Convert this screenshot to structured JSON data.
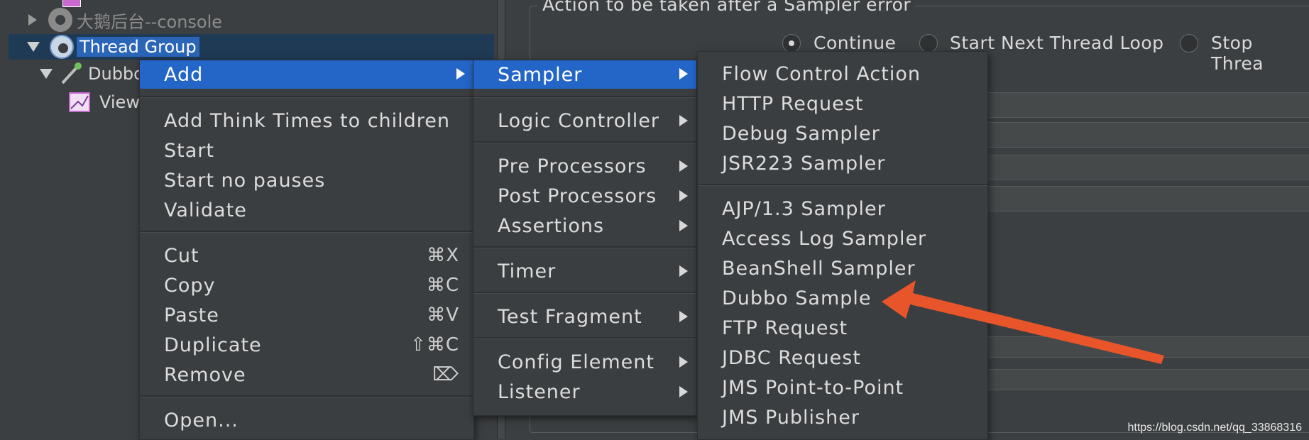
{
  "tree": {
    "items": [
      {
        "label": "大鹅后台--console"
      },
      {
        "label": "Thread Group"
      },
      {
        "label": "Dubbo"
      },
      {
        "label": "View"
      }
    ]
  },
  "error_panel": {
    "title": "Action to be taken after a Sampler error",
    "options": [
      "Continue",
      "Start Next Thread Loop",
      "Stop Threa"
    ],
    "selected": "Continue"
  },
  "context_menu": {
    "items": [
      {
        "label": "Add",
        "shortcut": "",
        "submenu": true
      },
      {
        "label": "Add Think Times to children",
        "shortcut": ""
      },
      {
        "label": "Start",
        "shortcut": ""
      },
      {
        "label": "Start no pauses",
        "shortcut": ""
      },
      {
        "label": "Validate",
        "shortcut": ""
      },
      {
        "label": "Cut",
        "shortcut": "⌘X"
      },
      {
        "label": "Copy",
        "shortcut": "⌘C"
      },
      {
        "label": "Paste",
        "shortcut": "⌘V"
      },
      {
        "label": "Duplicate",
        "shortcut": "⇧⌘C"
      },
      {
        "label": "Remove",
        "shortcut": "⌦"
      },
      {
        "label": "Open...",
        "shortcut": ""
      }
    ]
  },
  "add_submenu": {
    "items": [
      {
        "label": "Sampler"
      },
      {
        "label": "Logic Controller"
      },
      {
        "label": "Pre Processors"
      },
      {
        "label": "Post Processors"
      },
      {
        "label": "Assertions"
      },
      {
        "label": "Timer"
      },
      {
        "label": "Test Fragment"
      },
      {
        "label": "Config Element"
      },
      {
        "label": "Listener"
      }
    ]
  },
  "sampler_submenu": {
    "items": [
      {
        "label": "Flow Control Action"
      },
      {
        "label": "HTTP Request"
      },
      {
        "label": "Debug Sampler"
      },
      {
        "label": "JSR223 Sampler"
      },
      {
        "label": "AJP/1.3 Sampler"
      },
      {
        "label": "Access Log Sampler"
      },
      {
        "label": "BeanShell Sampler"
      },
      {
        "label": "Dubbo Sample"
      },
      {
        "label": "FTP Request"
      },
      {
        "label": "JDBC Request"
      },
      {
        "label": "JMS Point-to-Point"
      },
      {
        "label": "JMS Publisher"
      }
    ]
  },
  "annotation": {
    "arrow_color": "#e8552a",
    "points_to": "Dubbo Sample"
  },
  "colors": {
    "highlight": "#2366c8",
    "selected_tree": "#1c4a86",
    "background": "#3c3f41"
  },
  "watermark": "https://blog.csdn.net/qq_33868316"
}
